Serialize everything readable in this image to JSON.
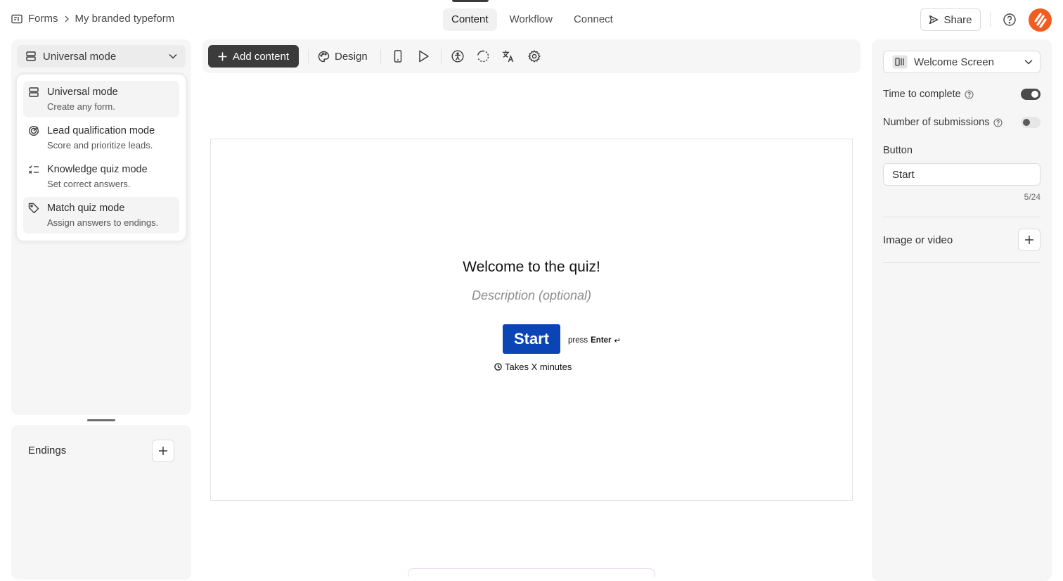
{
  "breadcrumb": {
    "root": "Forms",
    "current": "My branded typeform"
  },
  "nav_tabs": [
    {
      "label": "Content",
      "active": true
    },
    {
      "label": "Workflow",
      "active": false
    },
    {
      "label": "Connect",
      "active": false
    }
  ],
  "header": {
    "share_label": "Share"
  },
  "mode_selector": {
    "value": "Universal mode"
  },
  "mode_menu": {
    "items": [
      {
        "title": "Universal mode",
        "description": "Create any form.",
        "icon": "stack-icon"
      },
      {
        "title": "Lead qualification mode",
        "description": "Score and prioritize leads.",
        "icon": "target-icon"
      },
      {
        "title": "Knowledge quiz mode",
        "description": "Set correct answers.",
        "icon": "checklist-icon"
      },
      {
        "title": "Match quiz mode",
        "description": "Assign answers to endings.",
        "icon": "tag-icon"
      }
    ]
  },
  "endings": {
    "label": "Endings"
  },
  "toolbar": {
    "add_content_label": "Add content",
    "design_label": "Design"
  },
  "canvas": {
    "title": "Welcome to the quiz!",
    "description_placeholder": "Description (optional)",
    "start_label": "Start",
    "press_prefix": "press",
    "press_key": "Enter",
    "enter_symbol": "↵",
    "time_text": "Takes X minutes"
  },
  "right_panel": {
    "screen_type": "Welcome Screen",
    "time_to_complete_label": "Time to complete",
    "time_to_complete_on": true,
    "submissions_label": "Number of submissions",
    "submissions_on": false,
    "button_label": "Button",
    "button_value": "Start",
    "button_counter": "5/24",
    "image_label": "Image or video"
  },
  "colors": {
    "primary_button": "#0b45b5",
    "brand_avatar": "#f25c1f",
    "dark_button": "#3b3b3b"
  }
}
